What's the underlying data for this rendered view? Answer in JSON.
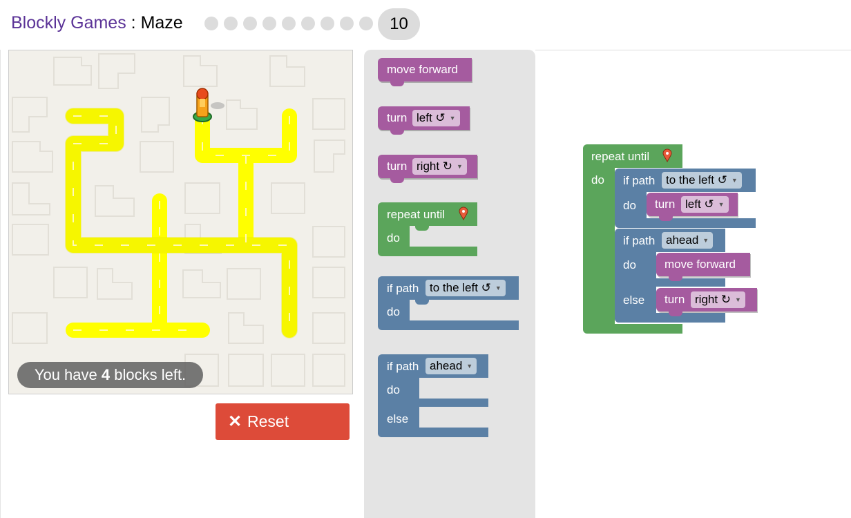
{
  "header": {
    "app_name": "Blockly Games",
    "separator": " : ",
    "game_name": "Maze",
    "levels": [
      1,
      2,
      3,
      4,
      5,
      6,
      7,
      8,
      9
    ],
    "current_level": "10"
  },
  "maze": {
    "blocks_left_prefix": "You have ",
    "blocks_left_count": "4",
    "blocks_left_suffix": " blocks left.",
    "path_color": "#ffff00",
    "background_color": "#f2f0ea"
  },
  "reset_button": {
    "label": "Reset",
    "color": "#dd4b39"
  },
  "toolbox": {
    "move_forward": "move forward",
    "turn_left": {
      "word": "turn",
      "option": "left ↺"
    },
    "turn_right": {
      "word": "turn",
      "option": "right ↻"
    },
    "repeat_until": {
      "label": "repeat until",
      "do": "do"
    },
    "if_path_left": {
      "label": "if path",
      "option": "to the left ↺",
      "do": "do"
    },
    "if_path_ahead": {
      "label": "if path",
      "option": "ahead",
      "do": "do",
      "else": "else"
    }
  },
  "workspace": {
    "repeat_label": "repeat until",
    "repeat_do": "do",
    "if1_label": "if path",
    "if1_option": "to the left ↺",
    "if1_do": "do",
    "if1_action_word": "turn",
    "if1_action_option": "left ↺",
    "if2_label": "if path",
    "if2_option": "ahead",
    "if2_do": "do",
    "if2_action": "move forward",
    "if2_else": "else",
    "else_action_word": "turn",
    "else_action_option": "right ↻"
  },
  "colors": {
    "motion_block": "#a55b9f",
    "loop_block": "#5ba55b",
    "logic_block": "#5b80a5"
  }
}
